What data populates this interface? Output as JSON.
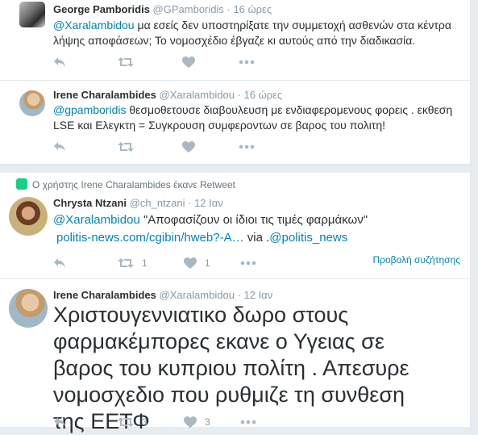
{
  "tweets": [
    {
      "name": "George Pamboridis",
      "handle": "@GPamboridis",
      "time": "16 ώρες",
      "mention": "@Xaralambidou",
      "text_rest": " μα εσείς δεν υποστηρίξατε την συμμετοχή ασθενών στα κέντρα λήψης αποφάσεων; Το νομοσχέδιο έβγαζε κι αυτούς από την διαδικασία."
    },
    {
      "name": "Irene Charalambides",
      "handle": "@Xaralambidou",
      "time": "16 ώρες",
      "mention": "@gpamboridis",
      "text_rest": " θεσμοθετουσε  διαβουλευση με ενδιαφερομενους φορεις . εκθεση LSE και  Ελεγκτη  = Συγκρουση συμφεροντων σε βαρος του πολιτη!"
    },
    {
      "retweet_context": "Ο χρήστης Irene Charalambides έκανε Retweet",
      "name": "Chrysta Ntzani",
      "handle": "@ch_ntzani",
      "time": "12 Ιαν",
      "mention": "@Xaralambidou",
      "text_rest": " \"Αποφασίζουν οι ίδιοι τις τιμές φαρμάκων\"",
      "link": "politis-news.com/cgibin/hweb?-A…",
      "via": " via .",
      "via_mention": "@politis_news",
      "retweets": "1",
      "likes": "1",
      "view_conversation": "Προβολή συζήτησης"
    },
    {
      "name": "Irene Charalambides",
      "handle": "@Xaralambidou",
      "time": "12 Ιαν",
      "text": "Χριστουγεννιατικο δωρο στους φαρμακέμπορες εκανε ο Υγειας σε βαρος του κυπριου πολίτη . Απεσυρε νομοσχεδιο που ρυθμιζε τη συνθεση της ΕΕΤΦ",
      "retweets": "3",
      "likes": "3"
    }
  ],
  "separator": " · ",
  "colors": {
    "link": "#0084b4",
    "muted": "#8899a6",
    "icon": "#aab8c2",
    "retweet_green": "#19cf86"
  },
  "icons": [
    "reply-icon",
    "retweet-icon",
    "like-heart-icon",
    "more-icon",
    "retweet-context-icon"
  ]
}
